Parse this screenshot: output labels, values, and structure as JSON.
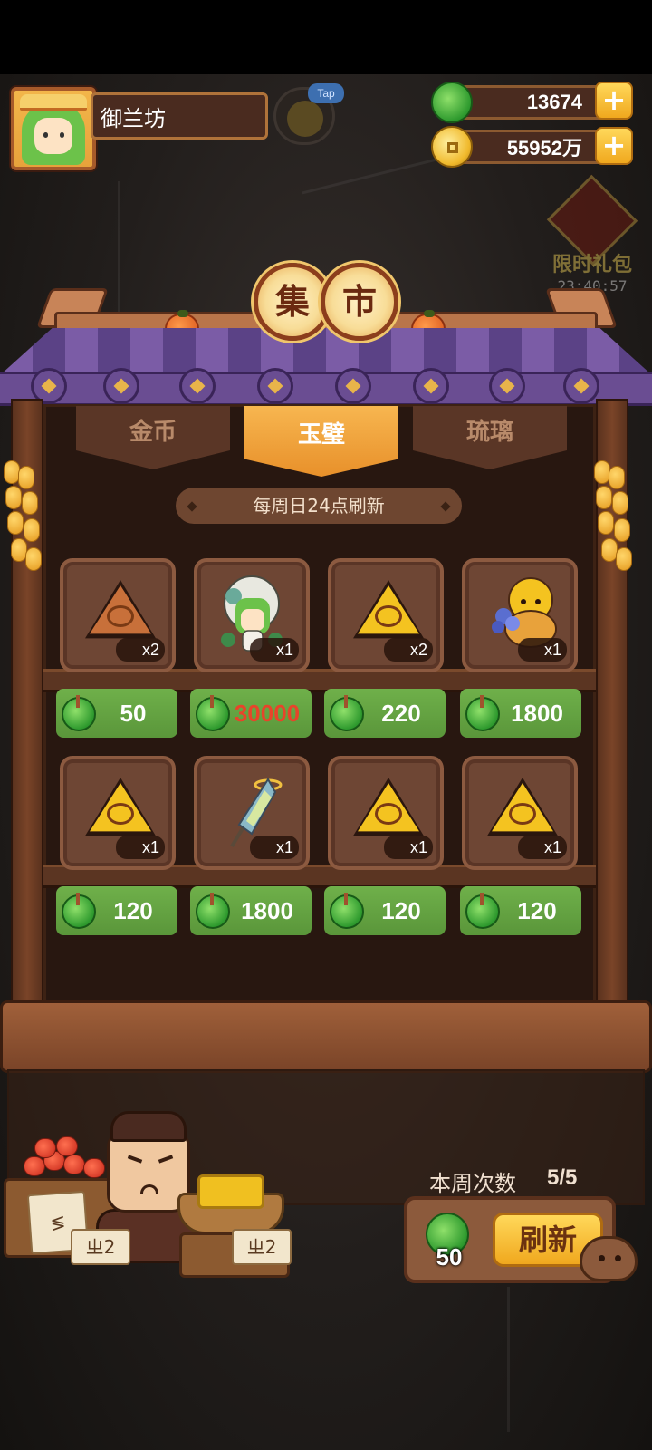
{
  "player": {
    "name": "御兰坊"
  },
  "tap_badge": {
    "label": "Tap"
  },
  "currencies": {
    "jade": "13674",
    "coins": "55952万"
  },
  "promo": {
    "title": "限时礼包",
    "timer": "23:40:57"
  },
  "market": {
    "title_chars": [
      "集",
      "市"
    ]
  },
  "tabs": [
    {
      "label": "金币",
      "active": false
    },
    {
      "label": "玉璧",
      "active": true
    },
    {
      "label": "琉璃",
      "active": false
    }
  ],
  "refresh_note": "每周日24点刷新",
  "items": [
    {
      "icon": "bronze-sun-token-icon",
      "qty": "x2",
      "price": "50"
    },
    {
      "icon": "green-haired-character-icon",
      "qty": "x1",
      "price": "30000",
      "price_color": "#e8442a"
    },
    {
      "icon": "gold-spiral-token-icon",
      "qty": "x2",
      "price": "220"
    },
    {
      "icon": "dog-with-flowers-icon",
      "qty": "x1",
      "price": "1800"
    },
    {
      "icon": "gold-spiral-token-icon",
      "qty": "x1",
      "price": "120"
    },
    {
      "icon": "lantern-ornament-icon",
      "qty": "x1",
      "price": "1800"
    },
    {
      "icon": "gold-deer-token-icon",
      "qty": "x1",
      "price": "120"
    },
    {
      "icon": "gold-fish-token-icon",
      "qty": "x1",
      "price": "120"
    }
  ],
  "weekly": {
    "label": "本周次数",
    "count": "5/5"
  },
  "refresh": {
    "cost": "50",
    "button_label": "刷新"
  },
  "vendor": {
    "sign_left": "ㄓ2",
    "sign_right": "ㄓ2"
  },
  "colors": {
    "jade_green": "#2e9a2e",
    "price_bg": "#6fb04a",
    "accent_gold": "#f0a81e",
    "roof_purple": "#6a4d92"
  }
}
